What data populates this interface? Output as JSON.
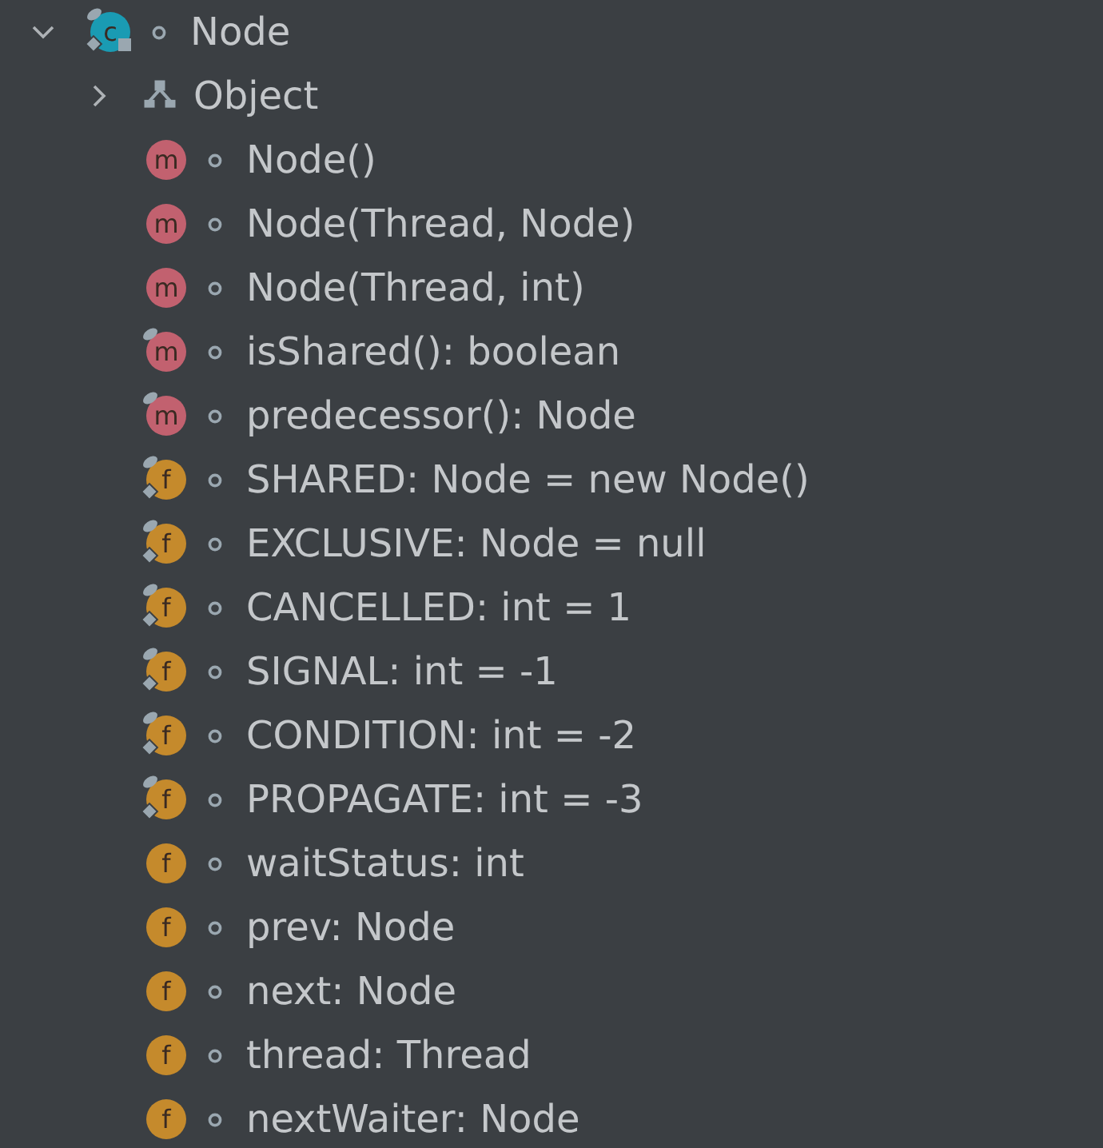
{
  "tree": {
    "label": "Node",
    "kind": "class",
    "badge": "c",
    "expanded": true,
    "final": true,
    "static": true,
    "locked": true,
    "package_private": true,
    "children": [
      {
        "label": "Object",
        "kind": "supertype",
        "expanded": false
      },
      {
        "label": "Node()",
        "kind": "method",
        "badge": "m",
        "final": false,
        "static": false,
        "package_private": true
      },
      {
        "label": "Node(Thread, Node)",
        "kind": "method",
        "badge": "m",
        "final": false,
        "static": false,
        "package_private": true
      },
      {
        "label": "Node(Thread, int)",
        "kind": "method",
        "badge": "m",
        "final": false,
        "static": false,
        "package_private": true
      },
      {
        "label": "isShared(): boolean",
        "kind": "method",
        "badge": "m",
        "final": true,
        "static": false,
        "package_private": true
      },
      {
        "label": "predecessor(): Node",
        "kind": "method",
        "badge": "m",
        "final": true,
        "static": false,
        "package_private": true
      },
      {
        "label": "SHARED: Node = new Node()",
        "kind": "field",
        "badge": "f",
        "final": true,
        "static": true,
        "package_private": true
      },
      {
        "label": "EXCLUSIVE: Node = null",
        "kind": "field",
        "badge": "f",
        "final": true,
        "static": true,
        "package_private": true
      },
      {
        "label": "CANCELLED: int = 1",
        "kind": "field",
        "badge": "f",
        "final": true,
        "static": true,
        "package_private": true
      },
      {
        "label": "SIGNAL: int = -1",
        "kind": "field",
        "badge": "f",
        "final": true,
        "static": true,
        "package_private": true
      },
      {
        "label": "CONDITION: int = -2",
        "kind": "field",
        "badge": "f",
        "final": true,
        "static": true,
        "package_private": true
      },
      {
        "label": "PROPAGATE: int = -3",
        "kind": "field",
        "badge": "f",
        "final": true,
        "static": true,
        "package_private": true
      },
      {
        "label": "waitStatus: int",
        "kind": "field",
        "badge": "f",
        "final": false,
        "static": false,
        "package_private": true
      },
      {
        "label": "prev: Node",
        "kind": "field",
        "badge": "f",
        "final": false,
        "static": false,
        "package_private": true
      },
      {
        "label": "next: Node",
        "kind": "field",
        "badge": "f",
        "final": false,
        "static": false,
        "package_private": true
      },
      {
        "label": "thread: Thread",
        "kind": "field",
        "badge": "f",
        "final": false,
        "static": false,
        "package_private": true
      },
      {
        "label": "nextWaiter: Node",
        "kind": "field",
        "badge": "f",
        "final": false,
        "static": false,
        "package_private": true
      }
    ]
  }
}
